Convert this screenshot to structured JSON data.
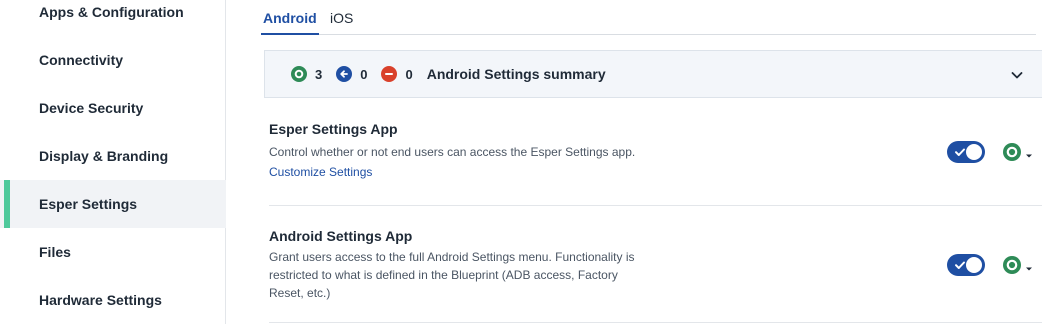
{
  "sidebar": {
    "items": [
      {
        "label": "Apps & Configuration"
      },
      {
        "label": "Connectivity"
      },
      {
        "label": "Device Security"
      },
      {
        "label": "Display & Branding"
      },
      {
        "label": "Esper Settings",
        "active": true
      },
      {
        "label": "Files"
      },
      {
        "label": "Hardware Settings"
      }
    ]
  },
  "tabs": [
    {
      "label": "Android",
      "active": true
    },
    {
      "label": "iOS"
    }
  ],
  "summary": {
    "enabled_count": "3",
    "inherited_count": "0",
    "disabled_count": "0",
    "title": "Android Settings summary"
  },
  "settings": [
    {
      "title": "Esper Settings App",
      "description": "Control whether or not end users can access the Esper Settings app.",
      "link": "Customize Settings",
      "enabled": true
    },
    {
      "title": "Android Settings App",
      "description": "Grant users access to the full Android Settings menu. Functionality is restricted to what is defined in the Blueprint (ADB access, Factory Reset, etc.)",
      "enabled": true
    }
  ],
  "colors": {
    "accent": "#1f4fa3",
    "active_indicator": "#4ec99b",
    "enabled_green": "#2e8b57",
    "inherited_blue": "#1f4fa3",
    "disabled_red": "#d9412b"
  },
  "icons": {
    "enabled": "circle-dot-icon",
    "inherited": "arrow-left-icon",
    "disabled": "minus-circle-icon",
    "expand": "chevron-down-icon",
    "status_caret": "caret-down-icon"
  }
}
